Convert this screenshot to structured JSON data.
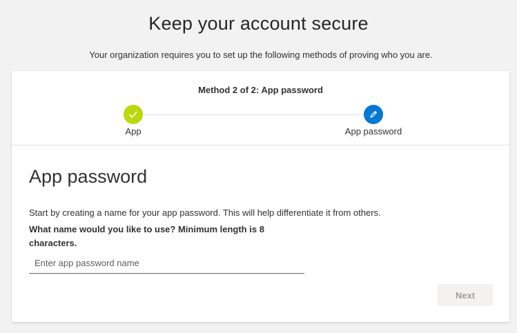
{
  "header": {
    "title": "Keep your account secure",
    "subtitle": "Your organization requires you to set up the following methods of proving who you are."
  },
  "progress": {
    "method_label": "Method 2 of 2: App password",
    "steps": [
      {
        "label": "App",
        "state": "completed",
        "icon": "checkmark-icon",
        "color": "#bad80a"
      },
      {
        "label": "App password",
        "state": "current",
        "icon": "pencil-icon",
        "color": "#0078d4"
      }
    ]
  },
  "form": {
    "section_title": "App password",
    "intro": "Start by creating a name for your app password. This will help differentiate it from others.",
    "question": "What name would you like to use? Minimum length is 8 characters.",
    "input": {
      "value": "",
      "placeholder": "Enter app password name"
    },
    "next_label": "Next",
    "next_enabled": false
  }
}
